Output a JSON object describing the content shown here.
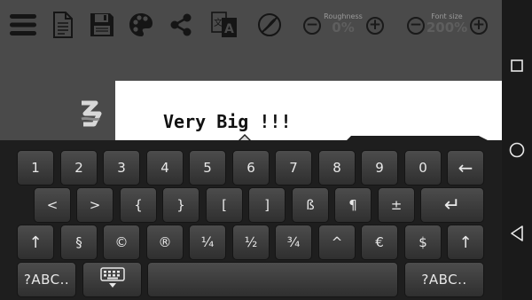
{
  "toolbar": {
    "menu_icon": "hamburger-icon",
    "new_icon": "document-icon",
    "save_icon": "floppy-disk-icon",
    "palette_icon": "palette-icon",
    "share_icon": "share-icon",
    "font_icon": "font-language-icon",
    "brush_icon": "no-brush-icon",
    "roughness": {
      "label": "Roughness",
      "value": "0%"
    },
    "font_size": {
      "label": "Font size",
      "value": "200%"
    },
    "minus": "−",
    "plus": "+"
  },
  "document": {
    "text": "Very Big !!!"
  },
  "keyboard": {
    "rows": [
      [
        "1",
        "2",
        "3",
        "4",
        "5",
        "6",
        "7",
        "8",
        "9",
        "0",
        "←"
      ],
      [
        "<",
        ">",
        "{",
        "}",
        "[",
        "]",
        "ß",
        "¶",
        "±",
        "↵"
      ],
      [
        "↑",
        "§",
        "©",
        "®",
        "¼",
        "½",
        "¾",
        "^",
        "€",
        "$",
        "↑"
      ],
      [
        "?ABC..",
        "⌨",
        "",
        "?ABC.."
      ]
    ]
  },
  "navbar": {
    "recents_icon": "square-icon",
    "home_icon": "circle-icon",
    "back_icon": "triangle-back-icon"
  },
  "colors": {
    "app_bg": "#4a4a4a",
    "keyboard_bg": "#1e1e1e",
    "key_top": "#4c4c4c",
    "key_bottom": "#2f2f2f",
    "paper": "#ffffff"
  }
}
